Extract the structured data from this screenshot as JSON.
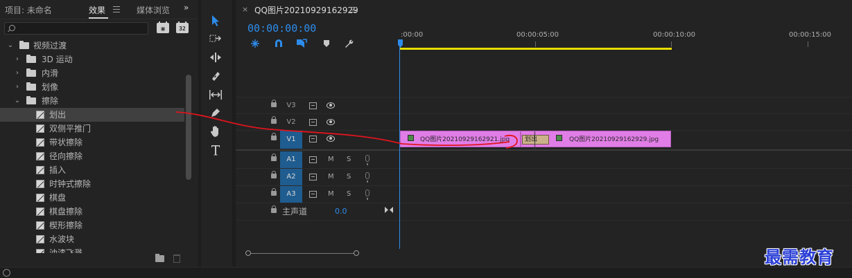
{
  "left_panel": {
    "tabs": [
      {
        "label": "项目: 未命名"
      },
      {
        "label": "效果"
      },
      {
        "label": "媒体浏览"
      }
    ],
    "overflow_label": "»",
    "search": {
      "value": "",
      "placeholder": ""
    },
    "badges": [
      {
        "label": "▣"
      },
      {
        "label": "32"
      }
    ],
    "tree": [
      {
        "type": "folder",
        "expanded": true,
        "level": 0,
        "label": "视频过渡"
      },
      {
        "type": "folder",
        "expanded": false,
        "level": 1,
        "label": "3D 运动"
      },
      {
        "type": "folder",
        "expanded": false,
        "level": 1,
        "label": "内滑"
      },
      {
        "type": "folder",
        "expanded": false,
        "level": 1,
        "label": "划像"
      },
      {
        "type": "folder",
        "expanded": true,
        "level": 1,
        "label": "擦除"
      },
      {
        "type": "effect",
        "level": 2,
        "label": "划出",
        "selected": true
      },
      {
        "type": "effect",
        "level": 2,
        "label": "双侧平推门"
      },
      {
        "type": "effect",
        "level": 2,
        "label": "带状擦除"
      },
      {
        "type": "effect",
        "level": 2,
        "label": "径向擦除"
      },
      {
        "type": "effect",
        "level": 2,
        "label": "插入"
      },
      {
        "type": "effect",
        "level": 2,
        "label": "时钟式擦除"
      },
      {
        "type": "effect",
        "level": 2,
        "label": "棋盘"
      },
      {
        "type": "effect",
        "level": 2,
        "label": "棋盘擦除"
      },
      {
        "type": "effect",
        "level": 2,
        "label": "楔形擦除"
      },
      {
        "type": "effect",
        "level": 2,
        "label": "水波块"
      },
      {
        "type": "effect",
        "level": 2,
        "label": "油漆飞溅"
      }
    ]
  },
  "tools": [
    {
      "name": "selection-tool-icon",
      "active": true
    },
    {
      "name": "track-select-tool-icon"
    },
    {
      "name": "ripple-edit-tool-icon"
    },
    {
      "name": "razor-tool-icon"
    },
    {
      "name": "slip-tool-icon"
    },
    {
      "name": "pen-tool-icon"
    },
    {
      "name": "hand-tool-icon"
    },
    {
      "name": "type-tool-icon"
    }
  ],
  "timeline": {
    "sequence_title": "QQ图片20210929162929",
    "close_label": "×",
    "timecode": "00:00:00:00",
    "ruler": [
      {
        "label": ":00:00",
        "t": 0
      },
      {
        "label": "00:00:05:00",
        "t": 5
      },
      {
        "label": "00:00:10:00",
        "t": 10
      },
      {
        "label": "00:00:15:00",
        "t": 15
      }
    ],
    "video_tracks": [
      {
        "label": "V3",
        "target": false
      },
      {
        "label": "V2",
        "target": false
      },
      {
        "label": "V1",
        "target": true
      }
    ],
    "audio_tracks": [
      {
        "label": "A1",
        "mute": "M",
        "solo": "S"
      },
      {
        "label": "A2",
        "mute": "M",
        "solo": "S"
      },
      {
        "label": "A3",
        "mute": "M",
        "solo": "S"
      }
    ],
    "master": {
      "label": "主声道",
      "value": "0.0"
    },
    "clips": [
      {
        "name": "QQ图片20210929162921.jpg"
      },
      {
        "name": "QQ图片20210929162929.jpg"
      }
    ],
    "transition_label": "划出"
  },
  "watermark": "最需教育",
  "colors": {
    "accent_blue": "#2d8ceb",
    "clip_pink": "#e17de6",
    "work_area_yellow": "#e8dd00",
    "annotation_red": "#e0141e",
    "watermark_blue": "#2b3fd6"
  }
}
